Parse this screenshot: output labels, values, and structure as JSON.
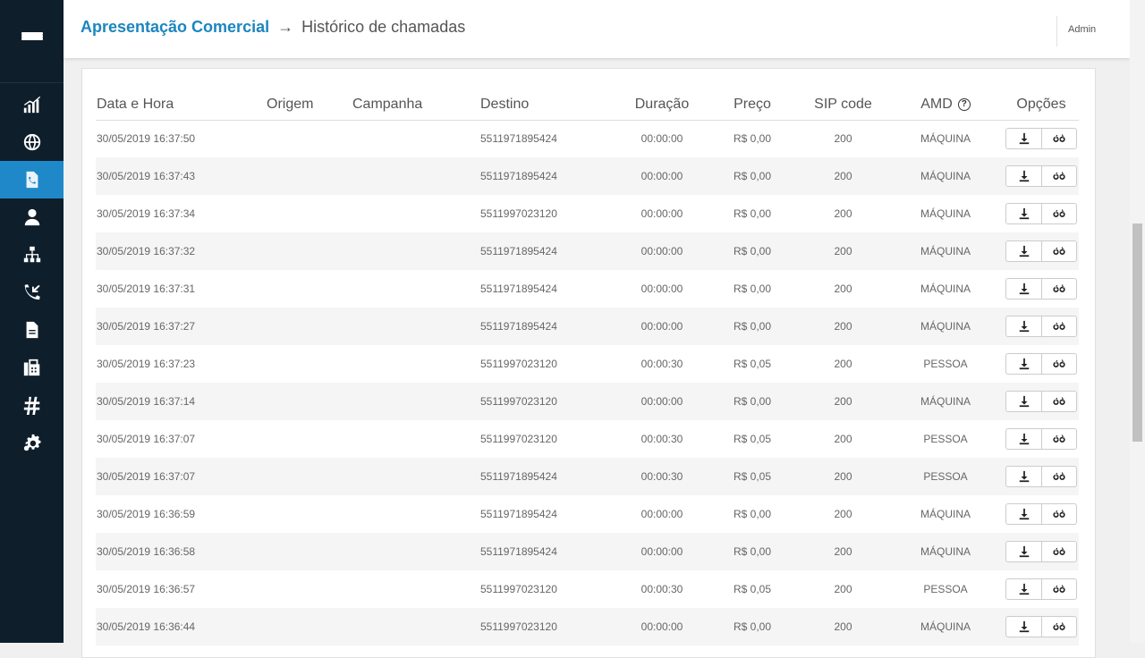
{
  "header": {
    "breadcrumb_root": "Apresentação Comercial",
    "breadcrumb_separator": "→",
    "breadcrumb_page": "Histórico de chamadas",
    "user": "Admin"
  },
  "sidebar": {
    "items": [
      {
        "icon": "chart-icon",
        "active": false
      },
      {
        "icon": "globe-icon",
        "active": false
      },
      {
        "icon": "call-history-icon",
        "active": true
      },
      {
        "icon": "user-icon",
        "active": false
      },
      {
        "icon": "sitemap-icon",
        "active": false
      },
      {
        "icon": "incoming-call-icon",
        "active": false
      },
      {
        "icon": "document-icon",
        "active": false
      },
      {
        "icon": "fax-icon",
        "active": false
      },
      {
        "icon": "hashtag-icon",
        "active": false
      },
      {
        "icon": "settings-icon",
        "active": false
      }
    ]
  },
  "table": {
    "columns": [
      "Data e Hora",
      "Origem",
      "Campanha",
      "Destino",
      "Duração",
      "Preço",
      "SIP code",
      "AMD",
      "Opções"
    ],
    "amd_help": "?",
    "rows": [
      {
        "datetime": "30/05/2019 16:37:50",
        "origem": "",
        "campanha": "",
        "destino": "5511971895424",
        "duracao": "00:00:00",
        "preco": "R$ 0,00",
        "sip": "200",
        "amd": "MÁQUINA"
      },
      {
        "datetime": "30/05/2019 16:37:43",
        "origem": "",
        "campanha": "",
        "destino": "5511971895424",
        "duracao": "00:00:00",
        "preco": "R$ 0,00",
        "sip": "200",
        "amd": "MÁQUINA"
      },
      {
        "datetime": "30/05/2019 16:37:34",
        "origem": "",
        "campanha": "",
        "destino": "5511997023120",
        "duracao": "00:00:00",
        "preco": "R$ 0,00",
        "sip": "200",
        "amd": "MÁQUINA"
      },
      {
        "datetime": "30/05/2019 16:37:32",
        "origem": "",
        "campanha": "",
        "destino": "5511971895424",
        "duracao": "00:00:00",
        "preco": "R$ 0,00",
        "sip": "200",
        "amd": "MÁQUINA"
      },
      {
        "datetime": "30/05/2019 16:37:31",
        "origem": "",
        "campanha": "",
        "destino": "5511971895424",
        "duracao": "00:00:00",
        "preco": "R$ 0,00",
        "sip": "200",
        "amd": "MÁQUINA"
      },
      {
        "datetime": "30/05/2019 16:37:27",
        "origem": "",
        "campanha": "",
        "destino": "5511971895424",
        "duracao": "00:00:00",
        "preco": "R$ 0,00",
        "sip": "200",
        "amd": "MÁQUINA"
      },
      {
        "datetime": "30/05/2019 16:37:23",
        "origem": "",
        "campanha": "",
        "destino": "5511997023120",
        "duracao": "00:00:30",
        "preco": "R$ 0,05",
        "sip": "200",
        "amd": "PESSOA"
      },
      {
        "datetime": "30/05/2019 16:37:14",
        "origem": "",
        "campanha": "",
        "destino": "5511997023120",
        "duracao": "00:00:00",
        "preco": "R$ 0,00",
        "sip": "200",
        "amd": "MÁQUINA"
      },
      {
        "datetime": "30/05/2019 16:37:07",
        "origem": "",
        "campanha": "",
        "destino": "5511997023120",
        "duracao": "00:00:30",
        "preco": "R$ 0,05",
        "sip": "200",
        "amd": "PESSOA"
      },
      {
        "datetime": "30/05/2019 16:37:07",
        "origem": "",
        "campanha": "",
        "destino": "5511971895424",
        "duracao": "00:00:30",
        "preco": "R$ 0,05",
        "sip": "200",
        "amd": "PESSOA"
      },
      {
        "datetime": "30/05/2019 16:36:59",
        "origem": "",
        "campanha": "",
        "destino": "5511971895424",
        "duracao": "00:00:00",
        "preco": "R$ 0,00",
        "sip": "200",
        "amd": "MÁQUINA"
      },
      {
        "datetime": "30/05/2019 16:36:58",
        "origem": "",
        "campanha": "",
        "destino": "5511971895424",
        "duracao": "00:00:00",
        "preco": "R$ 0,00",
        "sip": "200",
        "amd": "MÁQUINA"
      },
      {
        "datetime": "30/05/2019 16:36:57",
        "origem": "",
        "campanha": "",
        "destino": "5511997023120",
        "duracao": "00:00:30",
        "preco": "R$ 0,05",
        "sip": "200",
        "amd": "PESSOA"
      },
      {
        "datetime": "30/05/2019 16:36:44",
        "origem": "",
        "campanha": "",
        "destino": "5511997023120",
        "duracao": "00:00:00",
        "preco": "R$ 0,00",
        "sip": "200",
        "amd": "MÁQUINA"
      }
    ],
    "row_actions": [
      "download-icon",
      "listen-icon"
    ]
  },
  "colors": {
    "sidebar_bg": "#0e1e2b",
    "active_item": "#1f88c9",
    "breadcrumb_accent": "#1b86bf"
  }
}
